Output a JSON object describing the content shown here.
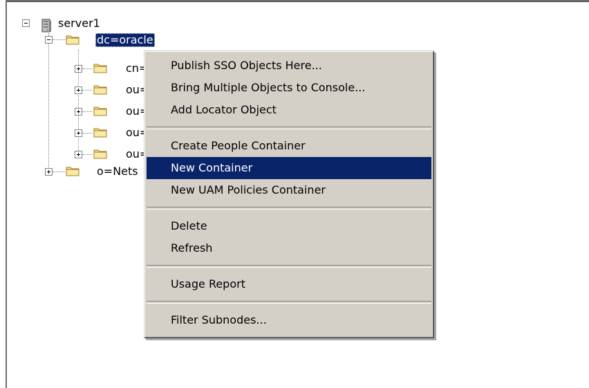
{
  "tree": {
    "root": {
      "label": "server1",
      "icon": "server-icon"
    },
    "selected": {
      "label": "dc=oracle",
      "icon": "folder-icon"
    },
    "children": [
      {
        "label": "cn="
      },
      {
        "label": "ou="
      },
      {
        "label": "ou="
      },
      {
        "label": "ou="
      },
      {
        "label": "ou="
      }
    ],
    "sibling": {
      "label": "o=Nets"
    }
  },
  "context_menu": {
    "groups": [
      [
        "Publish SSO Objects Here...",
        "Bring Multiple Objects to Console...",
        "Add Locator Object"
      ],
      [
        "Create People Container",
        "New Container",
        "New UAM Policies Container"
      ],
      [
        "Delete",
        "Refresh"
      ],
      [
        "Usage Report"
      ],
      [
        "Filter Subnodes..."
      ]
    ],
    "highlighted": "New Container"
  },
  "colors": {
    "selection": "#0a246a",
    "menu_bg": "#d4d0c8",
    "folder": "#f4dc8a"
  }
}
